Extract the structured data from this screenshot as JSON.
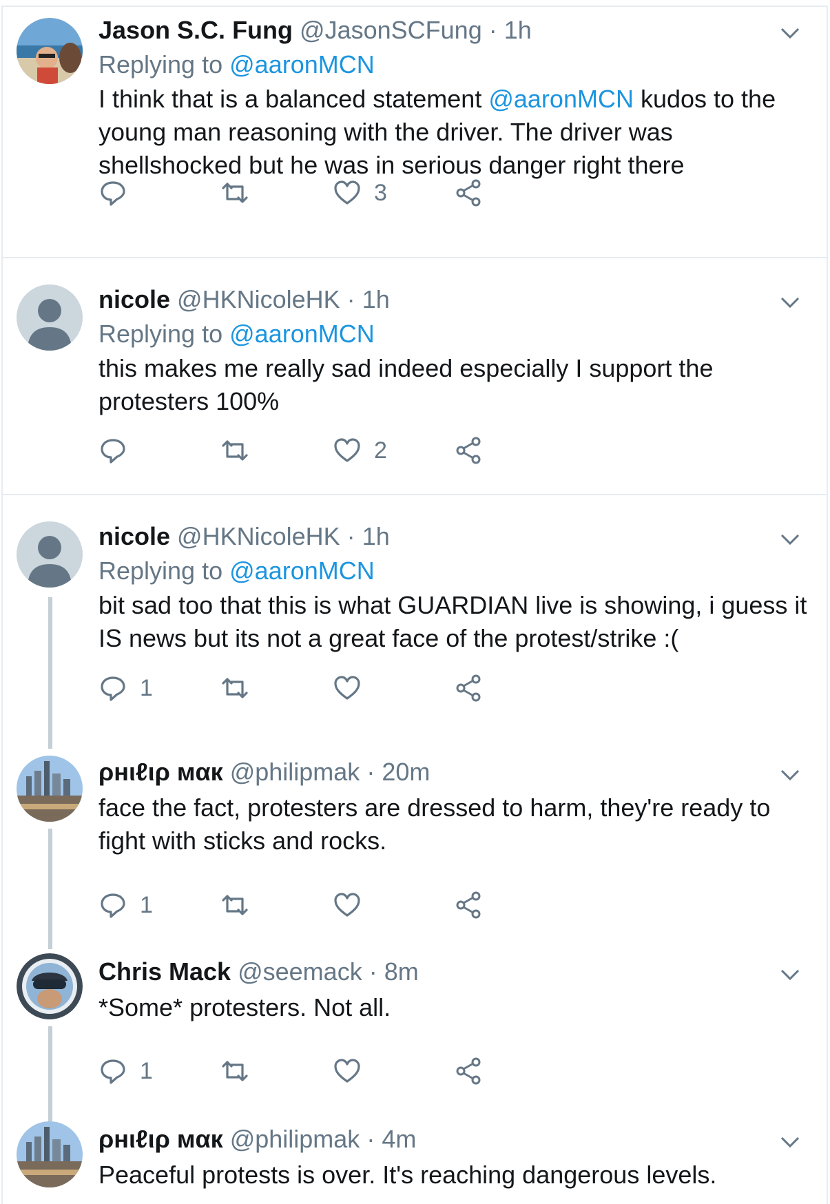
{
  "tweets": [
    {
      "name": "Jason S.C. Fung",
      "handle": "@JasonSCFung",
      "sep": "·",
      "time": "1h",
      "replying_prefix": "Replying to",
      "replying_to": "@aaronMCN",
      "text_parts": [
        "I think that is a balanced statement ",
        "@aaronMCN",
        " kudos to the young man reasoning with the driver. The driver was shellshocked but he was in serious danger right there"
      ],
      "reply_count": "",
      "retweet_count": "",
      "like_count": "3"
    },
    {
      "name": "nicole",
      "handle": "@HKNicoleHK",
      "sep": "·",
      "time": "1h",
      "replying_prefix": "Replying to",
      "replying_to": "@aaronMCN",
      "text": "this makes me really sad indeed especially I support the protesters 100%",
      "reply_count": "",
      "retweet_count": "",
      "like_count": "2"
    },
    {
      "name": "nicole",
      "handle": "@HKNicoleHK",
      "sep": "·",
      "time": "1h",
      "replying_prefix": "Replying to",
      "replying_to": "@aaronMCN",
      "text": "bit sad too that this is what GUARDIAN live is showing, i guess it IS news but its not a great face of the protest/strike :(",
      "reply_count": "1",
      "retweet_count": "",
      "like_count": ""
    },
    {
      "name": "ρнιℓιρ мαк",
      "handle": "@philipmak",
      "sep": "·",
      "time": "20m",
      "text": "face the fact, protesters are dressed to harm, they're ready to fight with sticks and rocks.",
      "reply_count": "1",
      "retweet_count": "",
      "like_count": ""
    },
    {
      "name": "Chris Mack",
      "handle": "@seemack",
      "sep": "·",
      "time": "8m",
      "text": "*Some* protesters. Not all.",
      "reply_count": "1",
      "retweet_count": "",
      "like_count": ""
    },
    {
      "name": "ρнιℓιρ мαк",
      "handle": "@philipmak",
      "sep": "·",
      "time": "4m",
      "text": "Peaceful protests is over. It's reaching dangerous levels."
    }
  ],
  "icons": {
    "reply": "reply-icon",
    "retweet": "retweet-icon",
    "like": "heart-icon",
    "share": "share-icon",
    "menu": "chevron-down-icon"
  },
  "colors": {
    "link": "#1b95e0",
    "secondary": "#657786",
    "thread_line": "#c4cfd6",
    "divider": "#e6ecf0"
  }
}
